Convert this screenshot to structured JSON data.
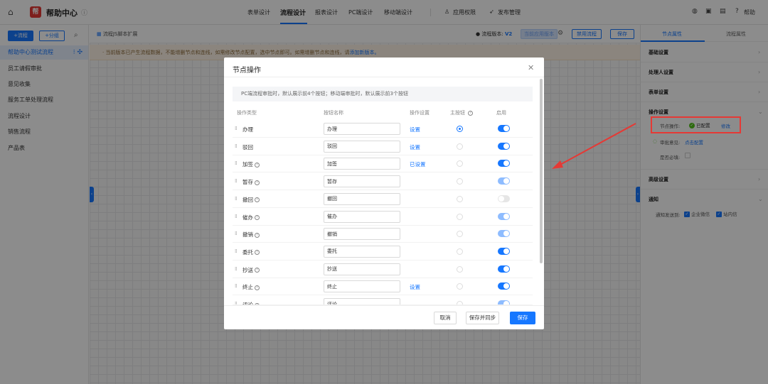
{
  "app": {
    "title": "帮助中心",
    "logo_text": "帮"
  },
  "nav": {
    "items": [
      "表单设计",
      "流程设计",
      "报表设计",
      "PC端设计",
      "移动端设计"
    ],
    "active": "流程设计",
    "right_items": [
      "应用权限",
      "发布管理"
    ]
  },
  "top_tools": {
    "help": "帮助"
  },
  "left": {
    "add_flow": "+流程",
    "add_group": "+分组",
    "items": [
      "帮助中心测试流程",
      "员工请假审批",
      "意见收集",
      "服务工单处理流程",
      "流程设计",
      "销售流程",
      "产品表"
    ],
    "active_index": 0
  },
  "center": {
    "ext_label": "流程JS脚本扩展",
    "version_label": "流程版本:",
    "version_value": "V2",
    "current_version": "当前应用版本",
    "disable_button": "禁用流程",
    "save_button": "保存",
    "notice_text": "· 当前版本已产生流程数据，不能增删节点和连线，如需修改节点配置，选中节点即可。如需增删节点和连线，请",
    "notice_link": "添加新版本。"
  },
  "right": {
    "tabs": [
      "节点属性",
      "流程属性"
    ],
    "sections": [
      "基础设置",
      "处理人设置",
      "表单设置",
      "操作设置",
      "高级设置",
      "通知"
    ],
    "node_ops_label": "节点操作:",
    "configured": "已配置",
    "edit": "修改",
    "comment_label": "审批意见:",
    "comment_link": "点击配置",
    "required_label": "是否必填:",
    "notify_label": "通知发送到:",
    "notify_options": [
      "企业微信",
      "站内信"
    ]
  },
  "modal": {
    "title": "节点操作",
    "tip": "PC端流程审批时，默认展示前4个按钮；移动端审批时，默认展示前3个按钮",
    "headers": [
      "操作类型",
      "按钮名称",
      "操作设置",
      "主按钮",
      "启用"
    ],
    "rows": [
      {
        "type": "办理",
        "name": "办理",
        "setting": "设置",
        "help": false,
        "main": true,
        "toggle": "on"
      },
      {
        "type": "驳回",
        "name": "驳回",
        "setting": "设置",
        "help": false,
        "main": false,
        "toggle": "on"
      },
      {
        "type": "加签",
        "name": "加签",
        "setting": "已设置",
        "help": true,
        "main": false,
        "toggle": "on"
      },
      {
        "type": "暂存",
        "name": "暂存",
        "setting": "",
        "help": true,
        "main": false,
        "toggle": "light"
      },
      {
        "type": "撤回",
        "name": "撤回",
        "setting": "",
        "help": true,
        "main": false,
        "toggle": "off"
      },
      {
        "type": "催办",
        "name": "催办",
        "setting": "",
        "help": true,
        "main": false,
        "toggle": "light"
      },
      {
        "type": "撤销",
        "name": "撤销",
        "setting": "",
        "help": true,
        "main": false,
        "toggle": "light"
      },
      {
        "type": "委托",
        "name": "委托",
        "setting": "",
        "help": true,
        "main": false,
        "toggle": "on"
      },
      {
        "type": "抄送",
        "name": "抄送",
        "setting": "",
        "help": true,
        "main": false,
        "toggle": "on"
      },
      {
        "type": "终止",
        "name": "终止",
        "setting": "设置",
        "help": true,
        "main": false,
        "toggle": "on"
      },
      {
        "type": "评论",
        "name": "评论",
        "setting": "",
        "help": true,
        "main": false,
        "toggle": "light"
      }
    ],
    "cancel": "取消",
    "save_sync": "保存并同步",
    "save": "保存"
  },
  "colors": {
    "accent": "#1677ff",
    "highlight": "#e53935",
    "success": "#52c41a"
  }
}
